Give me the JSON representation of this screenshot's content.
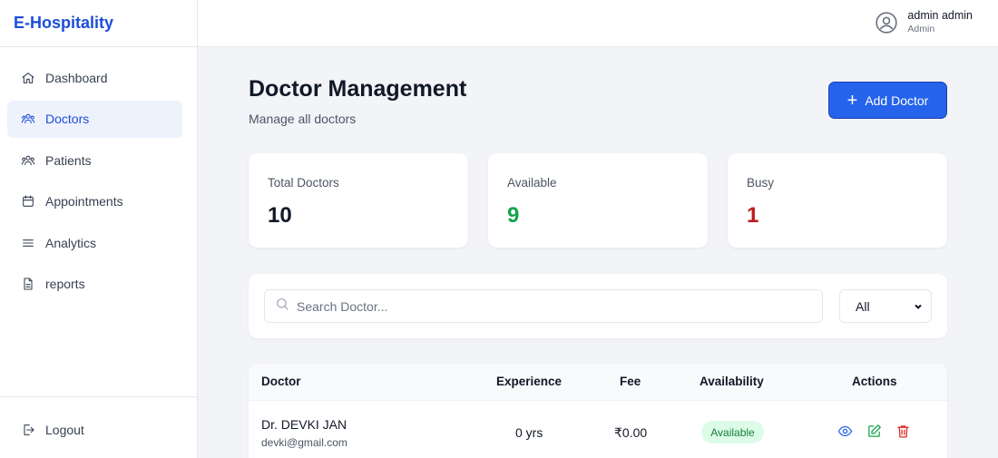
{
  "brand": "E-Hospitality",
  "sidebar": {
    "items": [
      {
        "label": "Dashboard",
        "icon": "home-icon"
      },
      {
        "label": "Doctors",
        "icon": "users-icon",
        "active": true
      },
      {
        "label": "Patients",
        "icon": "users-icon"
      },
      {
        "label": "Appointments",
        "icon": "calendar-icon"
      },
      {
        "label": "Analytics",
        "icon": "menu-lines-icon"
      },
      {
        "label": "reports",
        "icon": "file-icon"
      }
    ],
    "logout": "Logout"
  },
  "header": {
    "user_name": "admin admin",
    "user_role": "Admin"
  },
  "main": {
    "title": "Doctor Management",
    "subtitle": "Manage all doctors",
    "add_button": "Add Doctor",
    "stats": [
      {
        "label": "Total Doctors",
        "value": "10",
        "color": "#111827"
      },
      {
        "label": "Available",
        "value": "9",
        "color": "#16a34a"
      },
      {
        "label": "Busy",
        "value": "1",
        "color": "#b91c1c"
      }
    ],
    "search_placeholder": "Search Doctor...",
    "filter_selected": "All",
    "table": {
      "headers": [
        "Doctor",
        "Experience",
        "Fee",
        "Availability",
        "Actions"
      ],
      "rows": [
        {
          "name": "Dr. DEVKI JAN",
          "email": "devki@gmail.com",
          "experience": "0 yrs",
          "fee": "₹0.00",
          "availability": "Available"
        }
      ]
    }
  },
  "colors": {
    "accent": "#2563eb",
    "brand": "#1d4ed8",
    "available": "#16a34a",
    "busy": "#b91c1c",
    "view_icon": "#2563eb",
    "edit_icon": "#16a34a",
    "delete_icon": "#dc2626"
  }
}
